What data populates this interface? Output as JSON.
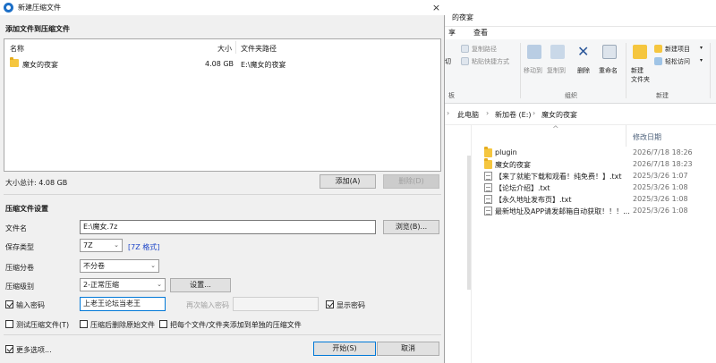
{
  "explorer": {
    "title": "的夜宴",
    "tabs": [
      "享",
      "查看"
    ],
    "ribbon": {
      "copy_path": "复制路径",
      "paste_shortcut": "粘贴快捷方式",
      "move_to": "移动到",
      "copy_to": "复制到",
      "delete": "删除",
      "rename": "重命名",
      "new_folder": "新建\n文件夹",
      "new_item": "新建项目",
      "easy_access": "轻松访问",
      "cut_fragment": "切",
      "group_fragment": "板",
      "organize_group": "组织",
      "new_group": "新建"
    },
    "breadcrumb": [
      "此电脑",
      "新加卷 (E:)",
      "魔女的夜宴"
    ],
    "columns": {
      "date": "修改日期"
    },
    "files": [
      {
        "name": "plugin",
        "date": "2026/7/18 18:26",
        "type": "folder"
      },
      {
        "name": "魔女的夜宴",
        "date": "2026/7/18 18:23",
        "type": "folder"
      },
      {
        "name": "【来了就能下载和观看！纯免费！】.txt",
        "date": "2025/3/26 1:07",
        "type": "txt"
      },
      {
        "name": "【论坛介绍】.txt",
        "date": "2025/3/26 1:08",
        "type": "txt"
      },
      {
        "name": "【永久地址发布页】.txt",
        "date": "2025/3/26 1:08",
        "type": "txt"
      },
      {
        "name": "最新地址及APP请发邮箱自动获取！！！...",
        "date": "2025/3/26 1:08",
        "type": "txt"
      }
    ]
  },
  "dialog": {
    "title": "新建压缩文件",
    "close_icon": "×",
    "add_section_title": "添加文件到压缩文件",
    "list_headers": {
      "name": "名称",
      "size": "大小",
      "path": "文件夹路径"
    },
    "list_rows": [
      {
        "name": "魔女的夜宴",
        "size": "4.08 GB",
        "path": "E:\\魔女的夜宴"
      }
    ],
    "total_size": "大小总计: 4.08 GB",
    "add_button": "添加(A)",
    "delete_button": "删除(D)",
    "settings_title": "压缩文件设置",
    "filename_label": "文件名",
    "filename_value": "E:\\魔女.7z",
    "browse_button": "浏览(B)...",
    "type_label": "保存类型",
    "type_value": "7Z",
    "type_link": "[7Z 格式]",
    "split_label": "压缩分卷",
    "split_value": "不分卷",
    "level_label": "压缩级别",
    "level_value": "2-正常压缩",
    "settings_button": "设置...",
    "password_checkbox": "输入密码",
    "password_value": "上老王论坛当老王",
    "confirm_label": "再次输入密码",
    "show_password": "显示密码",
    "test_checkbox": "测试压缩文件(T)",
    "delete_source_checkbox": "压缩后删除原始文件",
    "separate_checkbox": "把每个文件/文件夹添加到单独的压缩文件",
    "more_options": "更多选项...",
    "start_button": "开始(S)",
    "cancel_button": "取消"
  }
}
